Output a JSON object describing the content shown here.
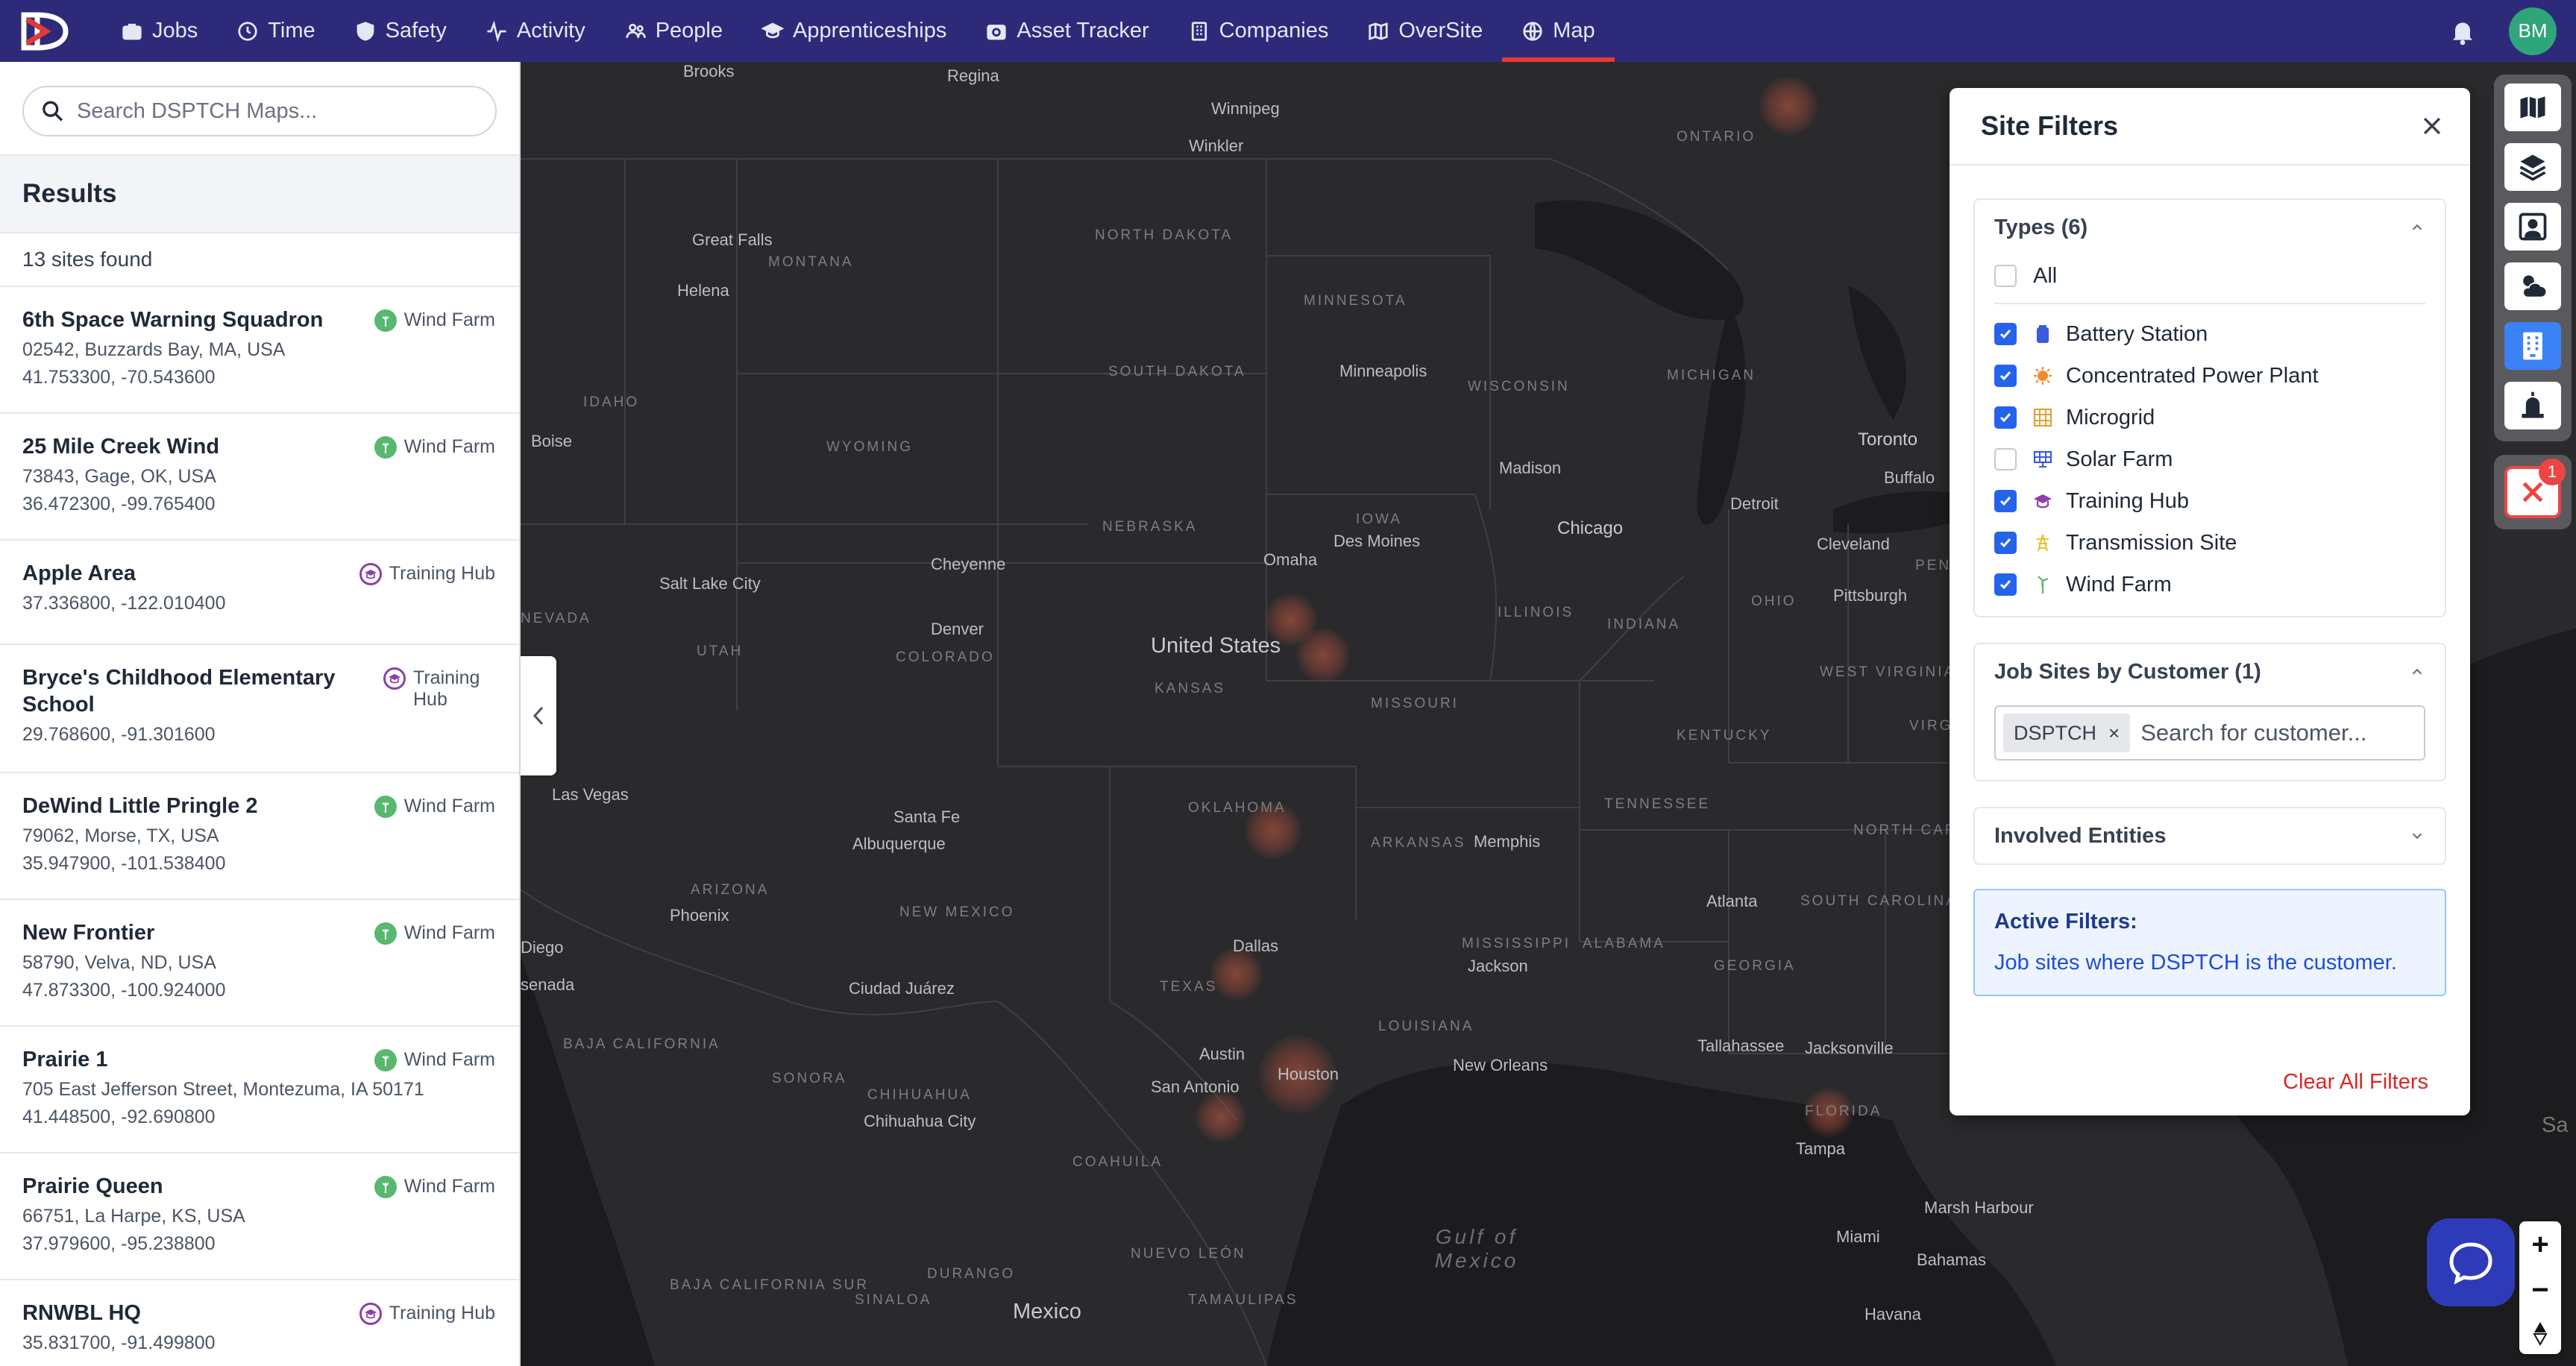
{
  "nav": {
    "items": [
      {
        "label": "Jobs",
        "icon": "briefcase-icon"
      },
      {
        "label": "Time",
        "icon": "clock-icon"
      },
      {
        "label": "Safety",
        "icon": "shield-icon"
      },
      {
        "label": "Activity",
        "icon": "activity-icon"
      },
      {
        "label": "People",
        "icon": "people-icon"
      },
      {
        "label": "Apprenticeships",
        "icon": "graduation-cap-icon"
      },
      {
        "label": "Asset Tracker",
        "icon": "camera-icon"
      },
      {
        "label": "Companies",
        "icon": "building-icon"
      },
      {
        "label": "OverSite",
        "icon": "map-icon"
      },
      {
        "label": "Map",
        "icon": "globe-icon"
      }
    ],
    "active": "Map",
    "avatar_initials": "BM",
    "accent_color": "#2e2a7a",
    "active_underline_color": "#e53935"
  },
  "search": {
    "placeholder": "Search DSPTCH Maps..."
  },
  "results": {
    "title": "Results",
    "count_text": "13 sites found",
    "sites": [
      {
        "name": "6th Space Warning Squadron",
        "address": "02542, Buzzards Bay, MA, USA",
        "coords": "41.753300, -70.543600",
        "type": "Wind Farm"
      },
      {
        "name": "25 Mile Creek Wind",
        "address": "73843, Gage, OK, USA",
        "coords": "36.472300, -99.765400",
        "type": "Wind Farm"
      },
      {
        "name": "Apple Area",
        "address": "",
        "coords": "37.336800, -122.010400",
        "type": "Training Hub"
      },
      {
        "name": "Bryce's Childhood Elementary School",
        "address": "",
        "coords": "29.768600, -91.301600",
        "type": "Training Hub"
      },
      {
        "name": "DeWind Little Pringle 2",
        "address": "79062, Morse, TX, USA",
        "coords": "35.947900, -101.538400",
        "type": "Wind Farm"
      },
      {
        "name": "New Frontier",
        "address": "58790, Velva, ND, USA",
        "coords": "47.873300, -100.924000",
        "type": "Wind Farm"
      },
      {
        "name": "Prairie 1",
        "address": "705 East Jefferson Street, Montezuma, IA 50171",
        "coords": "41.448500, -92.690800",
        "type": "Wind Farm"
      },
      {
        "name": "Prairie Queen",
        "address": "66751, La Harpe, KS, USA",
        "coords": "37.979600, -95.238800",
        "type": "Wind Farm"
      },
      {
        "name": "RNWBL HQ",
        "address": "",
        "coords": "35.831700, -91.499800",
        "type": "Training Hub"
      }
    ]
  },
  "map": {
    "labels": {
      "countries": [
        "United States",
        "Mexico"
      ],
      "regions": [
        "ONTARIO",
        "NORTH DAKOTA",
        "MONTANA",
        "MINNESOTA",
        "SOUTH DAKOTA",
        "WYOMING",
        "WISCONSIN",
        "MICHIGAN",
        "IDAHO",
        "NEBRASKA",
        "IOWA",
        "UTAH",
        "COLORADO",
        "KANSAS",
        "MISSOURI",
        "ILLINOIS",
        "INDIANA",
        "OHIO",
        "NEVADA",
        "OKLAHOMA",
        "ARKANSAS",
        "KENTUCKY",
        "TENNESSEE",
        "WEST VIRGINIA",
        "VIRGINIA",
        "NEW MEXICO",
        "ARIZONA",
        "TEXAS",
        "LOUISIANA",
        "MISSISSIPPI",
        "ALABAMA",
        "GEORGIA",
        "SOUTH CAROLINA",
        "NORTH CAROLINA",
        "FLORIDA",
        "SONORA",
        "CHIHUAHUA",
        "COAHUILA",
        "NUEVO LEÓN",
        "TAMAULIPAS",
        "DURANGO",
        "SINALOA",
        "BAJA CALIFORNIA",
        "BAJA CALIFORNIA SUR",
        "PENNSYLVANIA"
      ],
      "cities": [
        "Brooks",
        "Regina",
        "Winnipeg",
        "Winkler",
        "Great Falls",
        "Helena",
        "Boise",
        "Salt Lake City",
        "Cheyenne",
        "Denver",
        "Minneapolis",
        "Madison",
        "Chicago",
        "Detroit",
        "Toronto",
        "Buffalo",
        "Cleveland",
        "Pittsburgh",
        "Omaha",
        "Des Moines",
        "Las Vegas",
        "Santa Fe",
        "Albuquerque",
        "Phoenix",
        "Ciudad Juárez",
        "Chihuahua City",
        "Dallas",
        "Austin",
        "San Antonio",
        "Houston",
        "New Orleans",
        "Memphis",
        "Jackson",
        "Atlanta",
        "Tallahassee",
        "Jacksonville",
        "Tampa",
        "Miami",
        "Marsh Harbour",
        "Bahamas",
        "Havana",
        "Mexico"
      ],
      "water": [
        "Gulf of Mexico"
      ],
      "edge": [
        "evada",
        "Diego",
        "senada",
        "Sa"
      ]
    }
  },
  "filters": {
    "title": "Site Filters",
    "types_header": "Types (6)",
    "all_label": "All",
    "types": [
      {
        "label": "Battery Station",
        "checked": true,
        "icon": "battery-icon",
        "color": "#3b5bdb"
      },
      {
        "label": "Concentrated Power Plant",
        "checked": true,
        "icon": "sun-icon",
        "color": "#f08c2e"
      },
      {
        "label": "Microgrid",
        "checked": true,
        "icon": "grid-icon",
        "color": "#e0a23a"
      },
      {
        "label": "Solar Farm",
        "checked": false,
        "icon": "solar-panel-icon",
        "color": "#3b5bdb"
      },
      {
        "label": "Training Hub",
        "checked": true,
        "icon": "graduation-cap-icon",
        "color": "#8e3fa8"
      },
      {
        "label": "Transmission Site",
        "checked": true,
        "icon": "transmission-icon",
        "color": "#e6c229"
      },
      {
        "label": "Wind Farm",
        "checked": true,
        "icon": "wind-turbine-icon",
        "color": "#58b86f"
      }
    ],
    "customer_header": "Job Sites by Customer (1)",
    "customer_chip": "DSPTCH",
    "customer_placeholder": "Search for customer...",
    "entities_header": "Involved Entities",
    "active_title": "Active Filters:",
    "active_text": "Job sites where DSPTCH is the customer.",
    "clear_label": "Clear All Filters"
  },
  "toolbar": {
    "tools": [
      "map-icon",
      "layers-icon",
      "person-icon",
      "weather-icon",
      "building-icon",
      "beacon-icon"
    ],
    "active_tool": "building-icon",
    "alert_badge": "1"
  }
}
